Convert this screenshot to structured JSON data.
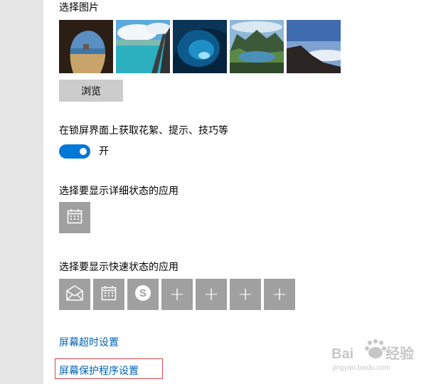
{
  "background_section": {
    "heading": "选择图片",
    "thumbnails": [
      {
        "name": "cave-beach-thumbnail"
      },
      {
        "name": "tropical-sea-thumbnail"
      },
      {
        "name": "ice-cave-thumbnail"
      },
      {
        "name": "mountain-lake-thumbnail"
      },
      {
        "name": "mountain-night-thumbnail"
      }
    ],
    "browse_label": "浏览"
  },
  "lockscreen_tips": {
    "label": "在锁屏界面上获取花絮、提示、技巧等",
    "toggle_state": "开",
    "toggle_on": true
  },
  "detailed_status": {
    "heading": "选择要显示详细状态的应用",
    "app_icon": "calendar-icon"
  },
  "quick_status": {
    "heading": "选择要显示快速状态的应用",
    "apps": [
      "mail-icon",
      "calendar-icon",
      "skype-icon",
      "plus-icon",
      "plus-icon",
      "plus-icon",
      "plus-icon"
    ]
  },
  "links": {
    "screen_timeout": "屏幕超时设置",
    "screensaver": "屏幕保护程序设置"
  },
  "watermark": {
    "brand": "Baidu经验",
    "url": "jingyan.baidu.com"
  },
  "colors": {
    "accent": "#0078d7",
    "link": "#0063b1",
    "tile": "#a0a0a0",
    "sidebar": "#e6e6e6",
    "highlight_border": "#e0474c"
  }
}
